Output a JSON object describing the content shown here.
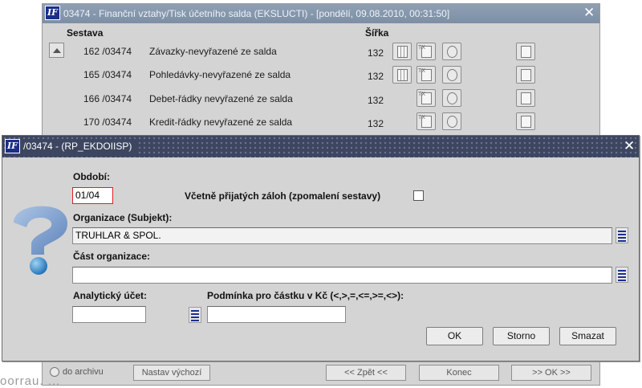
{
  "bg_window": {
    "title": "03474 - Finanční vztahy/Tisk účetního salda (EKSLUCTI) - [pondělí, 09.08.2010, 00:31:50]",
    "col_sestava": "Sestava",
    "col_sirka": "Šířka",
    "rows": [
      {
        "num": "162 /03474",
        "name": "Závazky-nevyřazené ze salda",
        "width": "132"
      },
      {
        "num": "165 /03474",
        "name": "Pohledávky-nevyřazené ze salda",
        "width": "132"
      },
      {
        "num": "166 /03474",
        "name": "Debet-řádky nevyřazené ze salda",
        "width": "132"
      },
      {
        "num": "170 /03474",
        "name": "Kredit-řádky nevyřazené ze salda",
        "width": "132"
      }
    ],
    "archive_label": "do archivu",
    "btn_defaults": "Nastav výchozí",
    "btn_back": "<< Zpět <<",
    "btn_end": "Konec",
    "btn_ok": ">> OK >>",
    "bottom_text": "oorrau. ..."
  },
  "dialog": {
    "title": "/03474 - (RP_EKDOIISP)",
    "label_period": "Období:",
    "period_value": "01/04",
    "label_deposits": "Včetně přijatých záloh (zpomalení sestavy)",
    "label_org": "Organizace (Subjekt):",
    "org_value": "TRUHLAR & SPOL.",
    "label_org_part": "Část organizace:",
    "org_part_value": "",
    "label_account": "Analytický účet:",
    "account_value": "",
    "label_condition": "Podmínka pro částku v Kč (<,>,=,<=,>=,<>):",
    "condition_value": "",
    "btn_ok": "OK",
    "btn_cancel": "Storno",
    "btn_delete": "Smazat"
  },
  "colors": {
    "bg_title": "#8fa0b4",
    "dialog_title": "#3d4660",
    "window_bg": "#d4d4d4",
    "error_border": "#e02020",
    "accent_blue": "#1d2f93"
  }
}
